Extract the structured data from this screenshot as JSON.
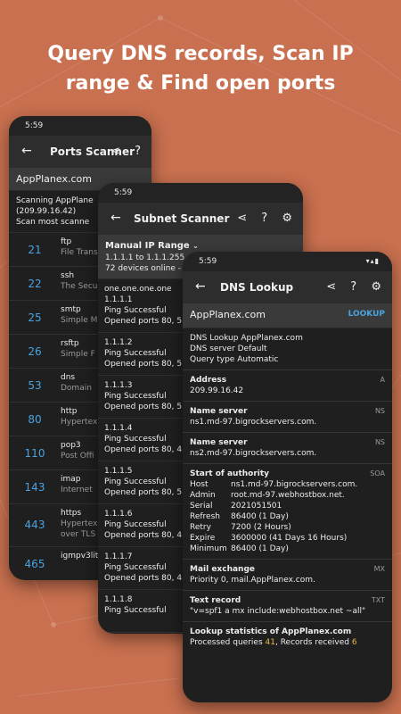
{
  "headline": {
    "line1": "Query DNS records, Scan IP",
    "line2": "range & Find open ports"
  },
  "ports_phone": {
    "time": "5:59",
    "title": "Ports Scanner",
    "input": "AppPlanex.com",
    "status_line1": "Scanning AppPlane",
    "status_line2": "(209.99.16.42)",
    "status_line3": "Scan most scanne",
    "ports": [
      {
        "num": "21",
        "name": "ftp",
        "desc": "File Trans"
      },
      {
        "num": "22",
        "name": "ssh",
        "desc": "The Secu"
      },
      {
        "num": "25",
        "name": "smtp",
        "desc": "Simple M"
      },
      {
        "num": "26",
        "name": "rsftp",
        "desc": "Simple F"
      },
      {
        "num": "53",
        "name": "dns",
        "desc": "Domain"
      },
      {
        "num": "80",
        "name": "http",
        "desc": "Hypertex"
      },
      {
        "num": "110",
        "name": "pop3",
        "desc": "Post Offi"
      },
      {
        "num": "143",
        "name": "imap",
        "desc": "Internet"
      },
      {
        "num": "443",
        "name": "https",
        "desc": "Hypertex",
        "desc2": "over TLS"
      },
      {
        "num": "465",
        "name": "igmpv3lit",
        "desc": ""
      }
    ]
  },
  "subnet_phone": {
    "time": "5:59",
    "title": "Subnet Scanner",
    "mode": "Manual IP Range",
    "range": "1.1.1.1 to 1.1.1.255",
    "online": "72 devices online -",
    "hosts": [
      {
        "l1": "one.one.one.one",
        "l2": "1.1.1.1",
        "l3": "Ping Successful",
        "l4": "Opened ports 80, 5"
      },
      {
        "l1": "1.1.1.2",
        "l2": "Ping Successful",
        "l3": "Opened ports 80, 5",
        "l4": ""
      },
      {
        "l1": "1.1.1.3",
        "l2": "Ping Successful",
        "l3": "Opened ports 80, 5",
        "l4": ""
      },
      {
        "l1": "1.1.1.4",
        "l2": "Ping Successful",
        "l3": "Opened ports 80, 4",
        "l4": ""
      },
      {
        "l1": "1.1.1.5",
        "l2": "Ping Successful",
        "l3": "Opened ports 80, 5",
        "l4": ""
      },
      {
        "l1": "1.1.1.6",
        "l2": "Ping Successful",
        "l3": "Opened ports 80, 4",
        "l4": ""
      },
      {
        "l1": "1.1.1.7",
        "l2": "Ping Successful",
        "l3": "Opened ports 80, 4",
        "l4": ""
      },
      {
        "l1": "1.1.1.8",
        "l2": "Ping Successful",
        "l3": "",
        "l4": ""
      }
    ]
  },
  "dns_phone": {
    "time": "5:59",
    "title": "DNS Lookup",
    "input": "AppPlanex.com",
    "lookup_label": "LOOKUP",
    "summary": {
      "line1": "DNS Lookup AppPlanex.com",
      "server_label": "DNS server",
      "server_value": "Default",
      "qtype_label": "Query type",
      "qtype_value": "Automatic"
    },
    "address": {
      "h": "Address",
      "v": "209.99.16.42",
      "tag": "A"
    },
    "ns1": {
      "h": "Name server",
      "v": "ns1.md-97.bigrockservers.com.",
      "tag": "NS"
    },
    "ns2": {
      "h": "Name server",
      "v": "ns2.md-97.bigrockservers.com.",
      "tag": "NS"
    },
    "soa": {
      "h": "Start of authority",
      "tag": "SOA",
      "rows": [
        {
          "k": "Host",
          "v": "ns1.md-97.bigrockservers.com."
        },
        {
          "k": "Admin",
          "v": "root.md-97.webhostbox.net."
        },
        {
          "k": "Serial",
          "v": "2021051501"
        },
        {
          "k": "Refresh",
          "v": "86400 (1 Day)"
        },
        {
          "k": "Retry",
          "v": "7200 (2 Hours)"
        },
        {
          "k": "Expire",
          "v": "3600000 (41 Days 16 Hours)"
        },
        {
          "k": "Minimum",
          "v": "86400 (1 Day)"
        }
      ]
    },
    "mx": {
      "h": "Mail exchange",
      "v": "Priority 0, mail.AppPlanex.com.",
      "tag": "MX"
    },
    "txt": {
      "h": "Text record",
      "v": "\"v=spf1 a mx include:webhostbox.net ~all\"",
      "tag": "TXT"
    },
    "stats": {
      "h": "Lookup statistics of AppPlanex.com",
      "q_label": "Processed queries",
      "q_value": "41",
      "r_label": ", Records received",
      "r_value": "6"
    }
  }
}
